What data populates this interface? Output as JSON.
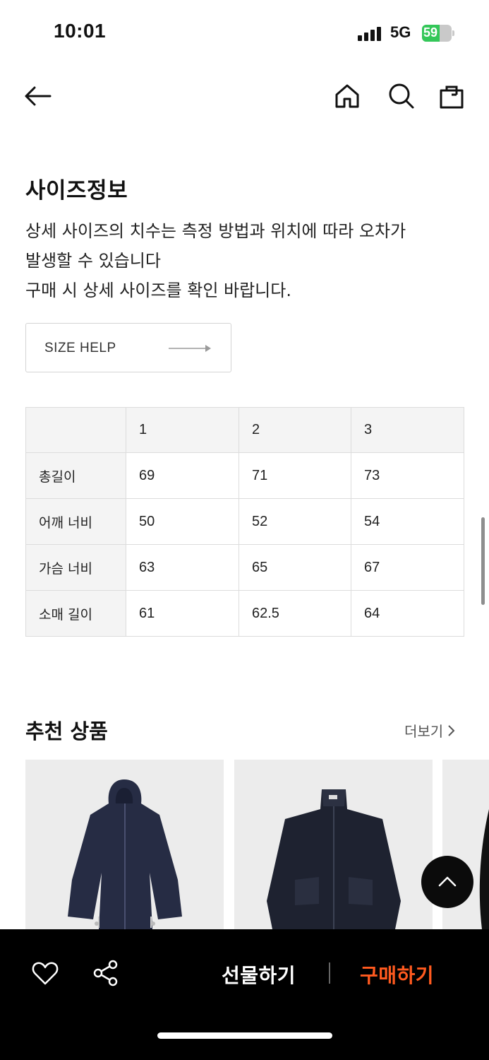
{
  "status": {
    "time": "10:01",
    "network": "5G",
    "battery": "59",
    "battery_level": 0.59
  },
  "nav": {
    "back_icon": "arrow-left-icon",
    "home_icon": "home-icon",
    "search_icon": "search-icon",
    "bag_icon": "shopping-bag-icon"
  },
  "size_info": {
    "title": "사이즈정보",
    "desc_lines": [
      "상세 사이즈의 치수는 측정 방법과 위치에 따라 오차가",
      "발생할 수 있습니다",
      "구매 시 상세 사이즈를 확인 바랍니다."
    ],
    "help_button": "SIZE HELP",
    "table": {
      "columns": [
        "",
        "1",
        "2",
        "3"
      ],
      "rows": [
        [
          "총길이",
          "69",
          "71",
          "73"
        ],
        [
          "어깨 너비",
          "50",
          "52",
          "54"
        ],
        [
          "가슴 너비",
          "63",
          "65",
          "67"
        ],
        [
          "소매 길이",
          "61",
          "62.5",
          "64"
        ]
      ]
    }
  },
  "recommended": {
    "title": "추천 상품",
    "more_label": "더보기"
  },
  "bottom_bar": {
    "gift_label": "선물하기",
    "buy_label": "구매하기",
    "buy_color": "#ff5a1f",
    "heart_icon": "heart-icon",
    "share_icon": "share-icon"
  },
  "scroll_top_icon": "chevron-up-icon"
}
